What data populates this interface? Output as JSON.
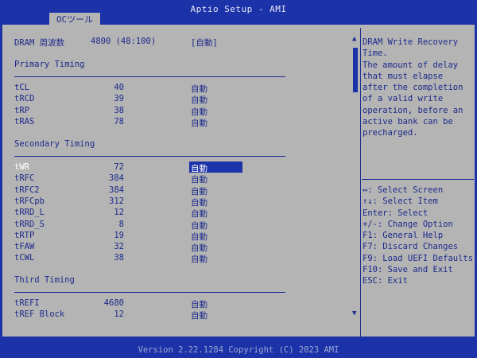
{
  "window": {
    "title": "Aptio Setup - AMI"
  },
  "tabs": [
    {
      "label": "OCツール"
    }
  ],
  "dram_frequency": {
    "label": "DRAM 周波数",
    "value": "4800 (48:100)",
    "option": "[自動]"
  },
  "sections": {
    "primary": "Primary Timing",
    "secondary": "Secondary Timing",
    "third": "Third Timing"
  },
  "primary_rows": [
    {
      "label": "tCL",
      "value": "40",
      "option": "自動"
    },
    {
      "label": "tRCD",
      "value": "39",
      "option": "自動"
    },
    {
      "label": "tRP",
      "value": "38",
      "option": "自動"
    },
    {
      "label": "tRAS",
      "value": "78",
      "option": "自動"
    }
  ],
  "secondary_rows": [
    {
      "label": "tWR",
      "value": "72",
      "option": "自動",
      "selected": true
    },
    {
      "label": "tRFC",
      "value": "384",
      "option": "自動"
    },
    {
      "label": "tRFC2",
      "value": "384",
      "option": "自動"
    },
    {
      "label": "tRFCpb",
      "value": "312",
      "option": "自動"
    },
    {
      "label": "tRRD_L",
      "value": "12",
      "option": "自動"
    },
    {
      "label": "tRRD_S",
      "value": "8",
      "option": "自動"
    },
    {
      "label": "tRTP",
      "value": "19",
      "option": "自動"
    },
    {
      "label": "tFAW",
      "value": "32",
      "option": "自動"
    },
    {
      "label": "tCWL",
      "value": "38",
      "option": "自動"
    }
  ],
  "third_rows": [
    {
      "label": "tREFI",
      "value": "4680",
      "option": "自動"
    },
    {
      "label": "tREF Block",
      "value": "12",
      "option": "自動"
    }
  ],
  "help_description": [
    "DRAM Write Recovery",
    "Time.",
    "The amount of delay",
    "that must elapse",
    "after the completion",
    "of a valid write",
    "operation, before an",
    "active bank can be",
    "precharged."
  ],
  "key_help": [
    "↔: Select Screen",
    "↑↓: Select Item",
    "Enter: Select",
    "+/-: Change Option",
    "F1: General Help",
    "F7: Discard Changes",
    "F9: Load UEFI Defaults",
    "F10: Save and Exit",
    "ESC: Exit"
  ],
  "scrollbar": {
    "up": "▲",
    "down": "▼"
  },
  "footer": "Version 2.22.1284 Copyright (C) 2023 AMI",
  "colors": {
    "background": "#1c32a8",
    "panel": "#b4b4b4",
    "text": "#1c2a8c"
  }
}
